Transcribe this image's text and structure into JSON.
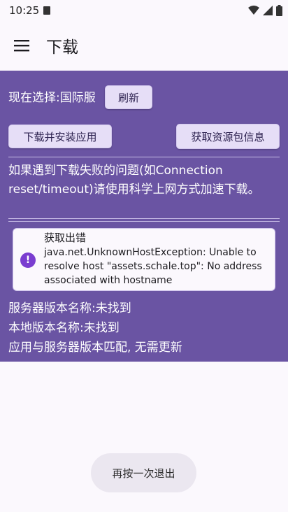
{
  "status_bar": {
    "time": "10:25"
  },
  "app_bar": {
    "title": "下载"
  },
  "server": {
    "label": "现在选择:国际服",
    "refresh_label": "刷新"
  },
  "actions": {
    "download_label": "下载并安装应用",
    "resource_label": "获取资源包信息"
  },
  "notice": "如果遇到下载失败的问题(如Connection reset/timeout)请使用科学上网方式加速下载。",
  "error": {
    "title": "获取出错",
    "message": "java.net.UnknownHostException: Unable to resolve host \"assets.schale.top\": No address associated with hostname"
  },
  "info": {
    "server_version": "服务器版本名称:未找到",
    "local_version": "本地版本名称:未找到",
    "match_status": "应用与服务器版本匹配, 无需更新"
  },
  "toast": {
    "text": "再按一次退出"
  },
  "colors": {
    "accent": "#6a54a3",
    "button_bg": "#e6def7",
    "error_icon": "#7a3dd0"
  }
}
